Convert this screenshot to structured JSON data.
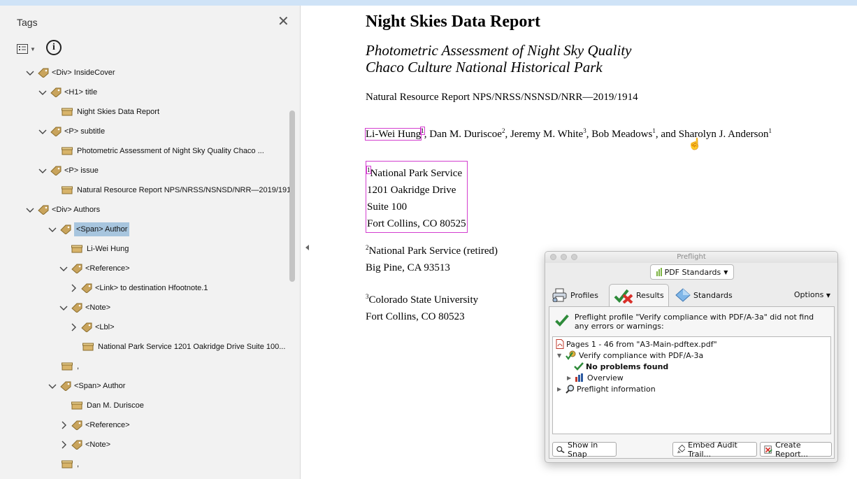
{
  "tags_panel": {
    "title": "Tags",
    "close": "✕",
    "tree": [
      {
        "label": "<Div> InsideCover",
        "kind": "tag"
      },
      {
        "label": "<H1> title",
        "kind": "tag"
      },
      {
        "label": "Night Skies Data Report",
        "kind": "content"
      },
      {
        "label": "<P> subtitle",
        "kind": "tag"
      },
      {
        "label": "Photometric Assessment of Night Sky Quality Chaco ...",
        "kind": "content"
      },
      {
        "label": "<P> issue",
        "kind": "tag"
      },
      {
        "label": "Natural Resource Report NPS/NRSS/NSNSD/NRR—2019/1914..",
        "kind": "content"
      },
      {
        "label": "<Div> Authors",
        "kind": "tag"
      },
      {
        "label": "<Span> Author",
        "kind": "tag",
        "selected": true
      },
      {
        "label": "Li-Wei Hung",
        "kind": "content"
      },
      {
        "label": "<Reference>",
        "kind": "tag"
      },
      {
        "label": "<Link> to destination Hfootnote.1",
        "kind": "tag"
      },
      {
        "label": "<Note>",
        "kind": "tag"
      },
      {
        "label": "<Lbl>",
        "kind": "tag"
      },
      {
        "label": "National Park Service 1201 Oakridge Drive Suite 100...",
        "kind": "content"
      },
      {
        "label": ",",
        "kind": "content"
      },
      {
        "label": "<Span> Author",
        "kind": "tag"
      },
      {
        "label": "Dan M. Duriscoe",
        "kind": "content"
      },
      {
        "label": "<Reference>",
        "kind": "tag"
      },
      {
        "label": "<Note>",
        "kind": "tag"
      },
      {
        "label": ",",
        "kind": "content"
      }
    ]
  },
  "document": {
    "title": "Night Skies Data Report",
    "subtitle_line1": "Photometric Assessment of Night Sky Quality",
    "subtitle_line2": "Chaco Culture National Historical Park",
    "issue": "Natural Resource Report NPS/NRSS/NSNSD/NRR—2019/1914",
    "authors": [
      {
        "name": "Li-Wei Hung",
        "sup": "1"
      },
      {
        "name": "Dan M. Duriscoe",
        "sup": "2"
      },
      {
        "name": "Jeremy M. White",
        "sup": "3"
      },
      {
        "name": "Bob Meadows",
        "sup": "1"
      },
      {
        "name": "Sharolyn J. Anderson",
        "sup": "1"
      }
    ],
    "sep_comma": ", ",
    "sep_and": ", and ",
    "affiliation1": {
      "sup": "1",
      "lines": [
        "National Park Service",
        "1201 Oakridge Drive",
        "Suite 100",
        "Fort Collins, CO 80525"
      ]
    },
    "affiliation2": {
      "sup": "2",
      "lines": [
        "National Park Service (retired)",
        "Big Pine, CA 93513"
      ]
    },
    "affiliation3": {
      "sup": "3",
      "lines": [
        "Colorado State University",
        "Fort Collins, CO 80523"
      ]
    }
  },
  "preflight": {
    "window_title": "Preflight",
    "standard_dropdown": "PDF Standards",
    "tabs": {
      "profiles": "Profiles",
      "results": "Results",
      "standards": "Standards"
    },
    "options": "Options",
    "summary": "Preflight profile \"Verify compliance with PDF/A-3a\" did not find any errors or warnings:",
    "results": {
      "pages": "Pages 1 - 46 from \"A3-Main-pdftex.pdf\"",
      "verify": "Verify compliance with PDF/A-3a",
      "no_problems": "No problems found",
      "overview": "Overview",
      "preflight_info": "Preflight information"
    },
    "buttons": {
      "snap": "Show in Snap",
      "embed": "Embed Audit Trail...",
      "report": "Create Report..."
    }
  },
  "colors": {
    "highlight": "#d33fcf",
    "selection": "#a7c5de",
    "check": "#2e8b3a"
  }
}
